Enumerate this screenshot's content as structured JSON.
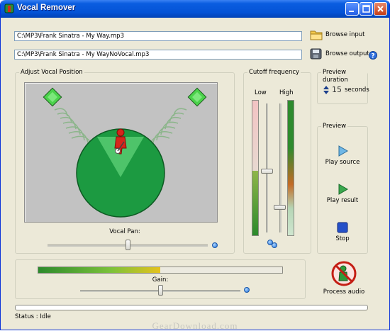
{
  "window": {
    "title": "Vocal Remover"
  },
  "files": {
    "input_path": "C:\\MP3\\Frank Sinatra -  My Way.mp3",
    "output_path": "C:\\MP3\\Frank Sinatra -  My WayNoVocal.mp3",
    "browse_input_label": "Browse input",
    "browse_output_label": "Browse output"
  },
  "vocal_position": {
    "group_label": "Adjust Vocal Position",
    "pan_label": "Vocal Pan:",
    "pan_value": 0.5
  },
  "cutoff": {
    "group_label": "Cutoff frequency",
    "low_label": "Low",
    "high_label": "High",
    "low_level": 0.48,
    "high_level": 0.2
  },
  "preview_duration": {
    "group_label": "Preview duration",
    "value": "15",
    "unit": "seconds"
  },
  "preview": {
    "group_label": "Preview",
    "play_source_label": "Play source",
    "play_result_label": "Play result",
    "stop_label": "Stop"
  },
  "gain": {
    "label": "Gain:",
    "value": 0.5
  },
  "process_label": "Process audio",
  "status": "Status : Idle",
  "watermark": "GearDownload.com",
  "colors": {
    "title_bar": "#0453d6",
    "stage_green": "#1c9a41",
    "stage_bg": "#c2c2c2"
  }
}
